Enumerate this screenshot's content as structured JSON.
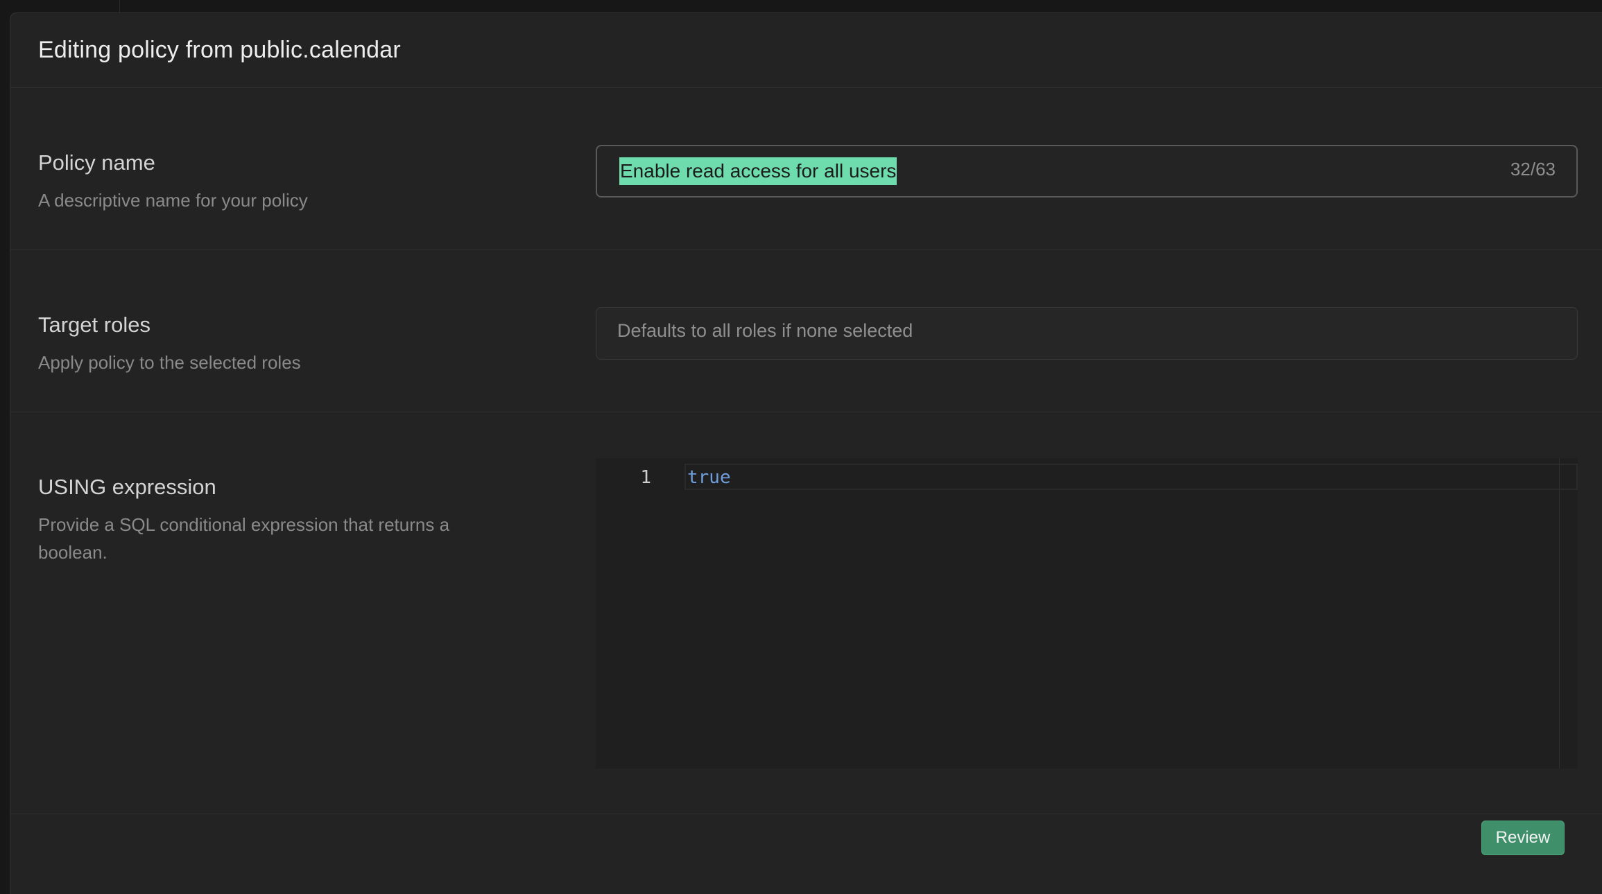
{
  "modal": {
    "title": "Editing policy from public.calendar"
  },
  "policy_name": {
    "label": "Policy name",
    "description": "A descriptive name for your policy",
    "value": "Enable read access for all users",
    "char_count": "32/63"
  },
  "target_roles": {
    "label": "Target roles",
    "description": "Apply policy to the selected roles",
    "placeholder": "Defaults to all roles if none selected"
  },
  "using_expression": {
    "label": "USING expression",
    "description": "Provide a SQL conditional expression that returns a boolean.",
    "line_number": "1",
    "code": "true"
  },
  "footer": {
    "review_label": "Review"
  },
  "colors": {
    "selection": "#6fdcae",
    "primary_button": "#3f8f6b",
    "code_keyword": "#6e9fdc",
    "background": "#232323"
  }
}
